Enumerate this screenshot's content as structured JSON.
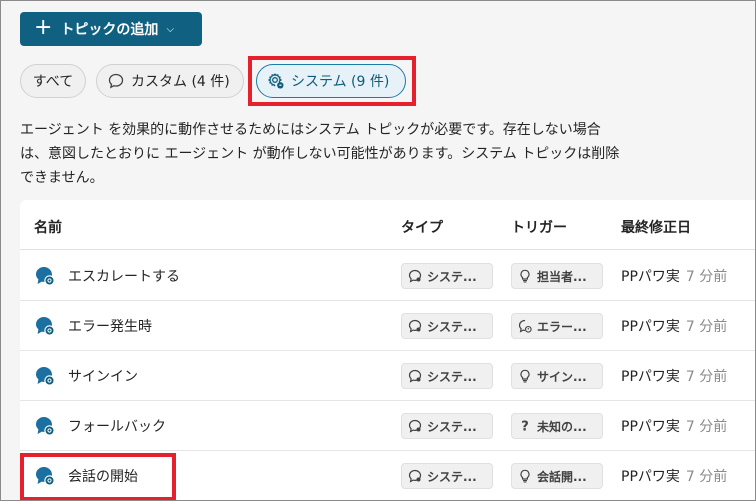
{
  "toolbar": {
    "add_topic_label": "トピックの追加"
  },
  "filters": {
    "all": "すべて",
    "custom": "カスタム (4 件)",
    "system": "システム (9 件)"
  },
  "description": "エージェント を効果的に動作させるためにはシステム トピックが必要です。存在しない場合は、意図したとおりに エージェント が動作しない可能性があります。システム トピックは削除できません。",
  "table": {
    "columns": {
      "name": "名前",
      "type": "タイプ",
      "trigger": "トリガー",
      "modified": "最終修正日"
    },
    "rows": [
      {
        "name": "エスカレートする",
        "type": "システ...",
        "trigger": "担当者...",
        "trigger_icon": "lightbulb-icon",
        "modified_by": "PPパワ実",
        "modified_when": "7 分前"
      },
      {
        "name": "エラー発生時",
        "type": "システ...",
        "trigger": "エラー...",
        "trigger_icon": "error-chat-icon",
        "modified_by": "PPパワ実",
        "modified_when": "7 分前"
      },
      {
        "name": "サインイン",
        "type": "システ...",
        "trigger": "サイン...",
        "trigger_icon": "lightbulb-icon",
        "modified_by": "PPパワ実",
        "modified_when": "7 分前"
      },
      {
        "name": "フォールバック",
        "type": "システ...",
        "trigger": "未知の...",
        "trigger_icon": "question-icon",
        "modified_by": "PPパワ実",
        "modified_when": "7 分前"
      },
      {
        "name": "会話の開始",
        "type": "システ...",
        "trigger": "会話開...",
        "trigger_icon": "lightbulb-icon",
        "modified_by": "PPパワ実",
        "modified_when": "7 分前"
      }
    ]
  },
  "colors": {
    "accent": "#106082",
    "highlight": "#e5212d",
    "system_pill_bg": "#e6f2f7"
  }
}
